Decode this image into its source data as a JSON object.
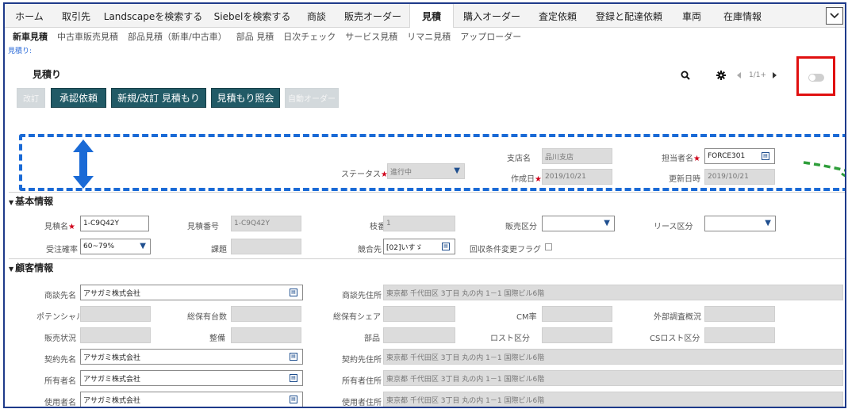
{
  "nav": {
    "items": [
      "ホーム",
      "取引先",
      "Landscapeを検索する",
      "Siebelを検索する",
      "商談",
      "販売オーダー",
      "見積",
      "購入オーダー",
      "査定依頼",
      "登録と配達依頼",
      "車両",
      "在庫情報"
    ],
    "active": "見積",
    "more_icon": "chevron-down-icon"
  },
  "subnav": {
    "items": [
      "新車見積",
      "中古車販売見積",
      "部品見積（新車/中古車）",
      "部品 見積",
      "日次チェック",
      "サービス見積",
      "リマニ見積",
      "アップローダー"
    ]
  },
  "breadcrumb": "見積り:",
  "page": {
    "title": "見積り",
    "pager": "1/1+"
  },
  "actions": {
    "revise": "改訂",
    "request_approval": "承認依頼",
    "new_revise": "新規/改訂 見積もり",
    "inquiry": "見積もり照会",
    "auto_order": "自動オーダー"
  },
  "header": {
    "status_label": "ステータス",
    "status_value": "進行中",
    "branch_label": "支店名",
    "branch_value": "品川支店",
    "created_label": "作成日",
    "created_value": "2019/10/21",
    "owner_label": "担当者名",
    "owner_value": "FORCE301",
    "updated_label": "更新日時",
    "updated_value": "2019/10/21"
  },
  "basic": {
    "section_title": "基本情報",
    "name_label": "見積名",
    "name_value": "1-C9Q42Y",
    "number_label": "見積番号",
    "number_value": "1-C9Q42Y",
    "branch_no_label": "枝番",
    "branch_no_value": "1",
    "sales_type_label": "販売区分",
    "sales_type_value": "",
    "lease_type_label": "リース区分",
    "lease_type_value": "",
    "probability_label": "受注確率",
    "probability_value": "60~79%",
    "tax_label": "課題",
    "tax_value": "",
    "competitor_label": "競合先",
    "competitor_value": "[02]いすゞ",
    "collection_flag_label": "回収条件変更フラグ"
  },
  "customer": {
    "section_title": "顧客情報",
    "deal_name_label": "商談先名",
    "deal_name_value": "アサガミ株式会社",
    "deal_address_label": "商談先住所",
    "deal_address_value": "東京都 千代田区 3丁目 丸の内 1－1 国際ビル6階",
    "potential_label": "ポテンシャル",
    "potential_value": "",
    "total_units_label": "総保有台数",
    "total_units_value": "",
    "share_label": "総保有シェア",
    "share_value": "",
    "cm_rate_label": "CM率",
    "cm_rate_value": "",
    "external_survey_label": "外部調査概況",
    "external_survey_value": "",
    "sales_status_label": "販売状況",
    "sales_status_value": "",
    "maintenance_label": "整備",
    "maintenance_value": "",
    "parts_label": "部品",
    "parts_value": "",
    "cost_type_label": "ロスト区分",
    "cost_type_value": "",
    "cs_cost_type_label": "CSロスト区分",
    "cs_cost_type_value": "",
    "contract_name_label": "契約先名",
    "contract_name_value": "アサガミ株式会社",
    "contract_address_label": "契約先住所",
    "contract_address_value": "東京都 千代田区 3丁目 丸の内 1－1 国際ビル6階",
    "owner_name_label": "所有者名",
    "owner_name_value": "アサガミ株式会社",
    "owner_address_label": "所有者住所",
    "owner_address_value": "東京都 千代田区 3丁目 丸の内 1－1 国際ビル6階",
    "user_name_label": "使用者名",
    "user_name_value": "アサガミ株式会社",
    "user_address_label": "使用者住所",
    "user_address_value": "東京都 千代田区 3丁目 丸の内 1－1 国際ビル6階"
  },
  "colors": {
    "primary_button": "#215a66",
    "highlight_red": "#e01010",
    "annotation_blue": "#1a6ad6",
    "annotation_green": "#2e9e3a"
  }
}
